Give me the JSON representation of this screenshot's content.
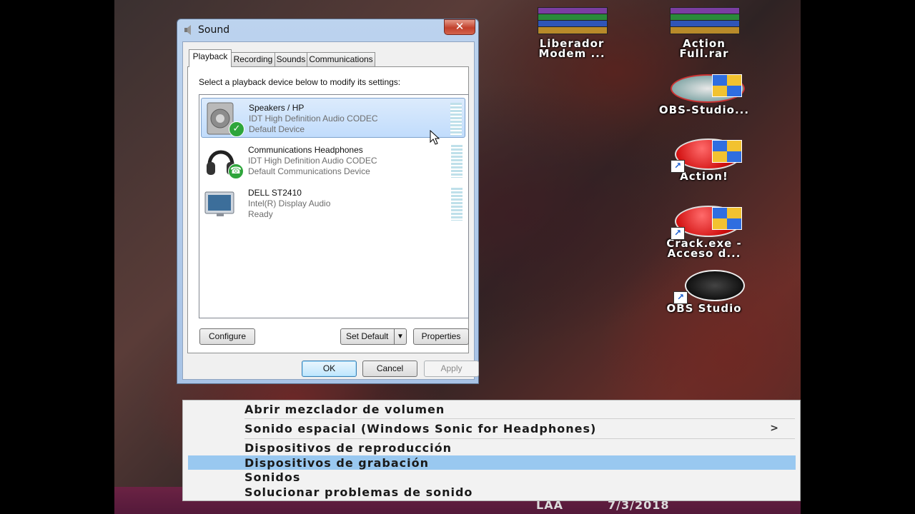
{
  "desktop": {
    "icons": [
      {
        "label": "Liberador\nModem ..."
      },
      {
        "label": "Action\nFull.rar"
      },
      {
        "label": "OBS-Studio..."
      },
      {
        "label": "Action!"
      },
      {
        "label": "Crack.exe -\nAcceso d..."
      },
      {
        "label": "OBS Studio"
      }
    ]
  },
  "window": {
    "title": "Sound",
    "close_label": "✕",
    "tabs": [
      "Playback",
      "Recording",
      "Sounds",
      "Communications"
    ],
    "active_tab": "Playback",
    "instruction": "Select a playback device below to modify its settings:",
    "devices": [
      {
        "name": "Speakers / HP",
        "driver": "IDT High Definition Audio CODEC",
        "status": "Default Device",
        "selected": true,
        "icon": "speaker-icon",
        "badge": "check"
      },
      {
        "name": "Communications Headphones",
        "driver": "IDT High Definition Audio CODEC",
        "status": "Default Communications Device",
        "selected": false,
        "icon": "headphones-icon",
        "badge": "phone"
      },
      {
        "name": "DELL ST2410",
        "driver": "Intel(R) Display Audio",
        "status": "Ready",
        "selected": false,
        "icon": "monitor-icon",
        "badge": "none"
      }
    ],
    "buttons": {
      "configure": "Configure",
      "set_default": "Set Default",
      "properties": "Properties",
      "ok": "OK",
      "cancel": "Cancel",
      "apply": "Apply"
    }
  },
  "context_menu": {
    "items": [
      "Abrir mezclador de volumen",
      "Sonido espacial (Windows Sonic for Headphones)",
      "Dispositivos de reproducción",
      "Dispositivos de grabación",
      "Sonidos",
      "Solucionar problemas de sonido"
    ],
    "submenu_arrow": ">",
    "highlighted_index": 3
  },
  "taskbar": {
    "language": "LAA",
    "date": "7/3/2018"
  },
  "colors": {
    "menu_highlight": "#99c8f0",
    "selected_device": "#c1dcfc",
    "taskbar": "#5e1c3f"
  }
}
